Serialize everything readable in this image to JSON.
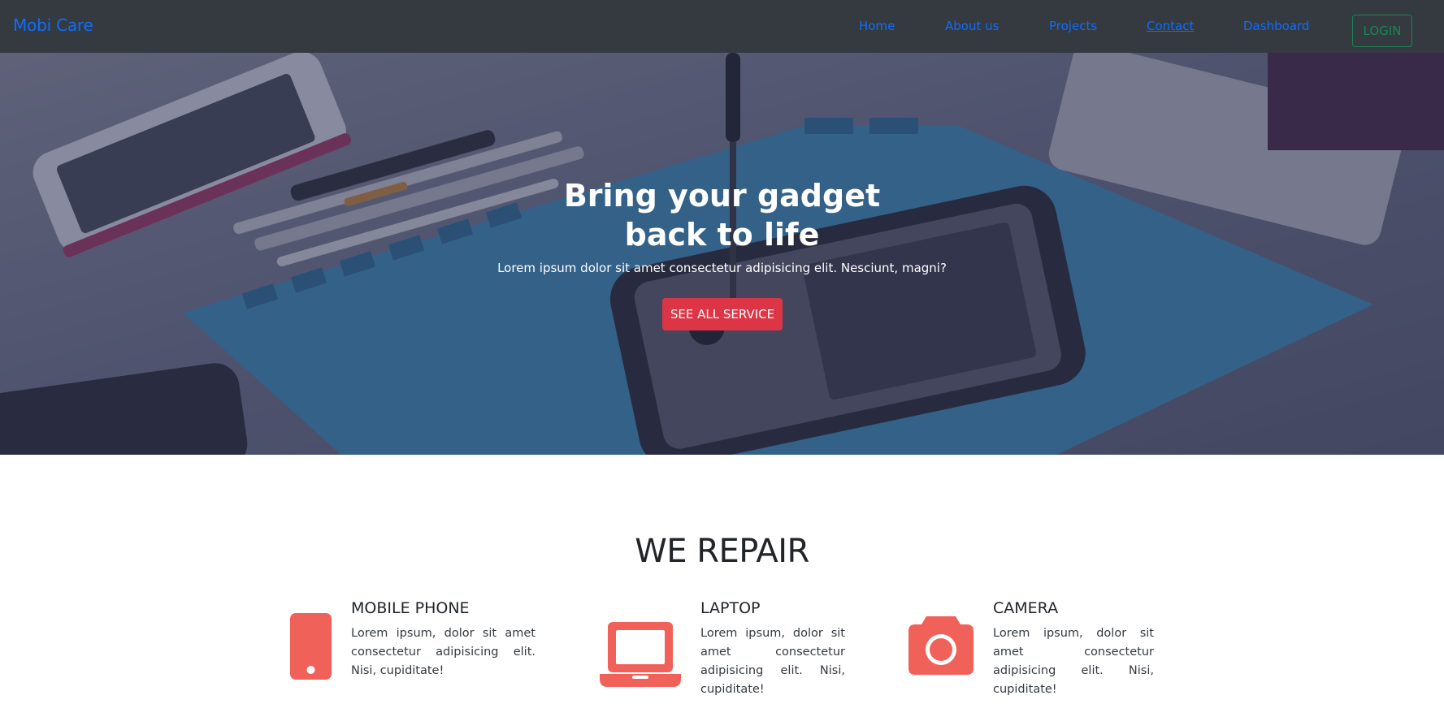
{
  "navbar": {
    "brand": "Mobi Care",
    "links": [
      {
        "label": "Home",
        "active": false
      },
      {
        "label": "About us",
        "active": false
      },
      {
        "label": "Projects",
        "active": false
      },
      {
        "label": "Contact",
        "active": true
      },
      {
        "label": "Dashboard",
        "active": false
      }
    ],
    "login_label": "LOGIN"
  },
  "hero": {
    "title_line1": "Bring your gadget",
    "title_line2": "back to life",
    "subtitle": "Lorem ipsum dolor sit amet consectetur adipisicing elit. Nesciunt, magni?",
    "button_label": "SEE ALL SERVICE"
  },
  "repair": {
    "title": "WE REPAIR",
    "services": [
      {
        "name": "MOBILE PHONE",
        "icon": "mobile-phone-icon",
        "description": "Lorem ipsum, dolor sit amet consectetur adipisicing elit. Nisi, cupiditate!"
      },
      {
        "name": "LAPTOP",
        "icon": "laptop-icon",
        "description": "Lorem ipsum, dolor sit amet consectetur adipisicing elit. Nisi, cupiditate!"
      },
      {
        "name": "CAMERA",
        "icon": "camera-icon",
        "description": "Lorem ipsum, dolor sit amet consectetur adipisicing elit. Nisi, cupiditate!"
      }
    ]
  },
  "colors": {
    "navbar_bg": "#343a40",
    "link": "#0d6efd",
    "login": "#198754",
    "cta": "#dc3545",
    "icon": "#f0615a"
  }
}
